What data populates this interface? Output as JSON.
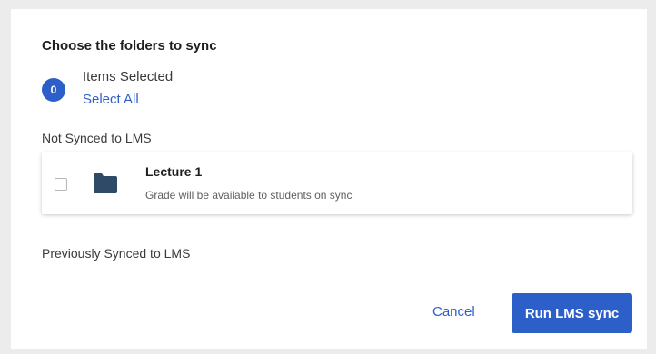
{
  "dialog": {
    "title": "Choose the folders to sync",
    "selection": {
      "count": "0",
      "label": "Items Selected",
      "select_all": "Select All"
    },
    "sections": {
      "not_synced": "Not Synced to LMS",
      "previously_synced": "Previously Synced to LMS"
    },
    "items": [
      {
        "name": "Lecture 1",
        "description": "Grade will be available to students on sync",
        "icon": "folder-icon",
        "checked": false
      }
    ],
    "actions": {
      "cancel": "Cancel",
      "run": "Run LMS sync"
    }
  },
  "colors": {
    "accent": "#2d5fc9",
    "folder": "#2f4a66",
    "background": "#ececec"
  }
}
